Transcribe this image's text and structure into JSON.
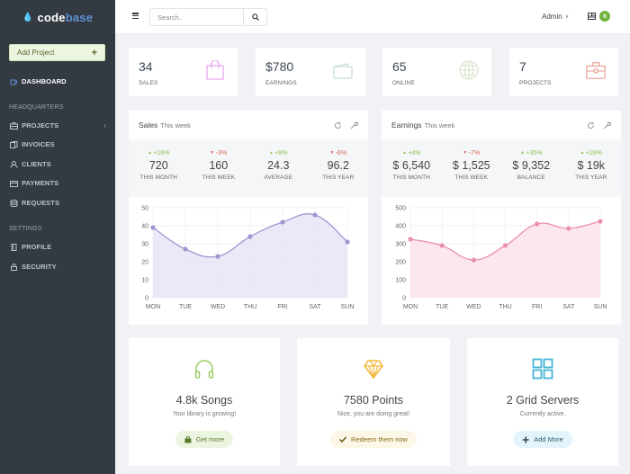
{
  "brand": {
    "prefix": "code",
    "suffix": "base"
  },
  "sidebar": {
    "add_project_label": "Add Project",
    "dashboard_label": "DASHBOARD",
    "headquarters_heading": "HEADQUARTERS",
    "settings_heading": "SETTINGS",
    "hq_items": [
      {
        "label": "PROJECTS",
        "icon": "briefcase-icon"
      },
      {
        "label": "INVOICES",
        "icon": "documents-icon"
      },
      {
        "label": "CLIENTS",
        "icon": "users-icon"
      },
      {
        "label": "PAYMENTS",
        "icon": "wallet-icon"
      },
      {
        "label": "REQUESTS",
        "icon": "database-icon"
      }
    ],
    "settings_items": [
      {
        "label": "PROFILE",
        "icon": "profile-icon"
      },
      {
        "label": "SECURITY",
        "icon": "lock-icon"
      }
    ]
  },
  "topbar": {
    "search_placeholder": "Search..",
    "user_label": "Admin",
    "notification_count": "6"
  },
  "tiles": [
    {
      "value": "34",
      "label": "SALES",
      "icon": "shopping-bag-icon",
      "color": "#e6a7ee"
    },
    {
      "value": "$780",
      "label": "EARNINGS",
      "icon": "wallet-icon",
      "color": "#c9ddd6"
    },
    {
      "value": "65",
      "label": "ONLINE",
      "icon": "globe-icon",
      "color": "#dde6d2"
    },
    {
      "value": "7",
      "label": "PROJECTS",
      "icon": "briefcase-icon",
      "color": "#e9a49a"
    }
  ],
  "sales_widget": {
    "title": "Sales",
    "subtitle": "This week",
    "stats": [
      {
        "delta": "+16%",
        "dir": "up",
        "value": "720",
        "label": "THIS MONTH"
      },
      {
        "delta": "-3%",
        "dir": "down",
        "value": "160",
        "label": "THIS WEEK"
      },
      {
        "delta": "+9%",
        "dir": "up",
        "value": "24.3",
        "label": "AVERAGE"
      },
      {
        "delta": "-6%",
        "dir": "down",
        "value": "96.2",
        "label": "THIS YEAR"
      }
    ]
  },
  "earnings_widget": {
    "title": "Earnings",
    "subtitle": "This week",
    "stats": [
      {
        "delta": "+4%",
        "dir": "up",
        "value": "$ 6,540",
        "label": "THIS MONTH"
      },
      {
        "delta": "-7%",
        "dir": "down",
        "value": "$ 1,525",
        "label": "THIS WEEK"
      },
      {
        "delta": "+35%",
        "dir": "up",
        "value": "$ 9,352",
        "label": "BALANCE"
      },
      {
        "delta": "+28%",
        "dir": "up",
        "value": "$ 19k",
        "label": "THIS YEAR"
      }
    ]
  },
  "chart_data": [
    {
      "type": "area",
      "title": "Sales This week",
      "categories": [
        "MON",
        "TUE",
        "WED",
        "THU",
        "FRI",
        "SAT",
        "SUN"
      ],
      "series": [
        {
          "name": "Sales",
          "values": [
            39,
            27,
            23,
            34,
            42,
            46,
            31
          ]
        }
      ],
      "yticks": [
        0,
        10,
        20,
        30,
        40,
        50
      ],
      "ylim": [
        0,
        50
      ],
      "grid": true,
      "color": "#9f97d1",
      "fill": "#e9e7f6"
    },
    {
      "type": "area",
      "title": "Earnings This week",
      "categories": [
        "MON",
        "TUE",
        "WED",
        "THU",
        "FRI",
        "SAT",
        "SUN"
      ],
      "series": [
        {
          "name": "Earnings",
          "values": [
            325,
            290,
            210,
            290,
            410,
            385,
            425
          ]
        }
      ],
      "yticks": [
        0,
        100,
        200,
        300,
        400,
        500
      ],
      "ylim": [
        0,
        500
      ],
      "grid": true,
      "color": "#eb8fb0",
      "fill": "#fce4ee"
    }
  ],
  "cards": [
    {
      "title": "4.8k Songs",
      "subtitle": "Your library is growing!",
      "button": "Get more",
      "icon": "headphones-icon",
      "button_icon": "bag-icon",
      "accent": "#9ccc65",
      "btn_bg": "#ebf5df",
      "btn_color": "#5a7a2e"
    },
    {
      "title": "7580 Points",
      "subtitle": "Nice, you are doing great!",
      "button": "Redeem them now",
      "icon": "diamond-icon",
      "button_icon": "check-icon",
      "accent": "#f3b93f",
      "btn_bg": "#fcf7e6",
      "btn_color": "#8a6d1c"
    },
    {
      "title": "2 Grid Servers",
      "subtitle": "Currently active.",
      "button": "Add More",
      "icon": "grid-icon",
      "button_icon": "plus-icon",
      "accent": "#44b4d5",
      "btn_bg": "#e3f4fc",
      "btn_color": "#2b5b6e"
    }
  ]
}
